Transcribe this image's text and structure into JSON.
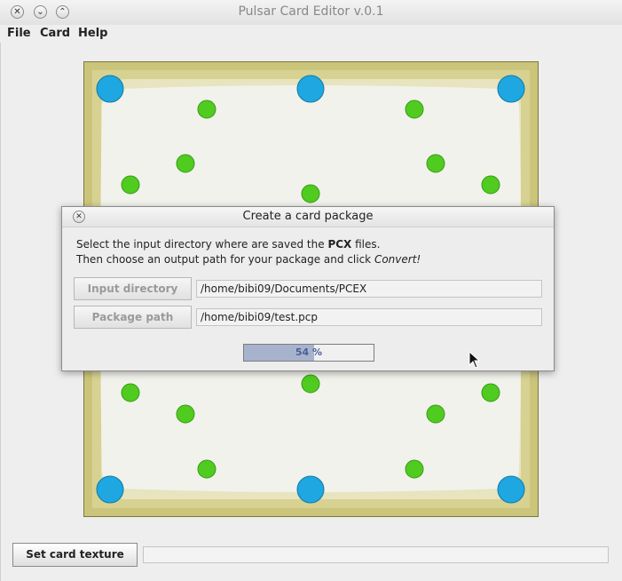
{
  "window": {
    "title": "Pulsar Card Editor v.0.1"
  },
  "menu": {
    "items": [
      "File",
      "Card",
      "Help"
    ]
  },
  "icons": {
    "close": "close-icon",
    "minimize": "minimize-icon",
    "maximize": "maximize-icon",
    "cursor": "mouse-pointer-icon"
  },
  "card": {
    "frame_color": "#cfc98a",
    "inner_color": "#f2f2ec",
    "corner_dot_color": "#1ea7e0",
    "field_dot_color": "#4fcc1f"
  },
  "dialog": {
    "title": "Create a card package",
    "line1_prefix": "Select the input directory where are saved the ",
    "line1_bold": "PCX",
    "line1_suffix": " files.",
    "line2_prefix": "Then choose an output path for your package and click ",
    "line2_italic": "Convert!",
    "input_dir_label": "Input directory",
    "input_dir_value": "/home/bibi09/Documents/PCEX",
    "package_path_label": "Package path",
    "package_path_value": "/home/bibi09/test.pcp",
    "progress_text": "54 %",
    "progress_value": 0.54
  },
  "bottom": {
    "set_texture_label": "Set card texture",
    "texture_value": ""
  }
}
